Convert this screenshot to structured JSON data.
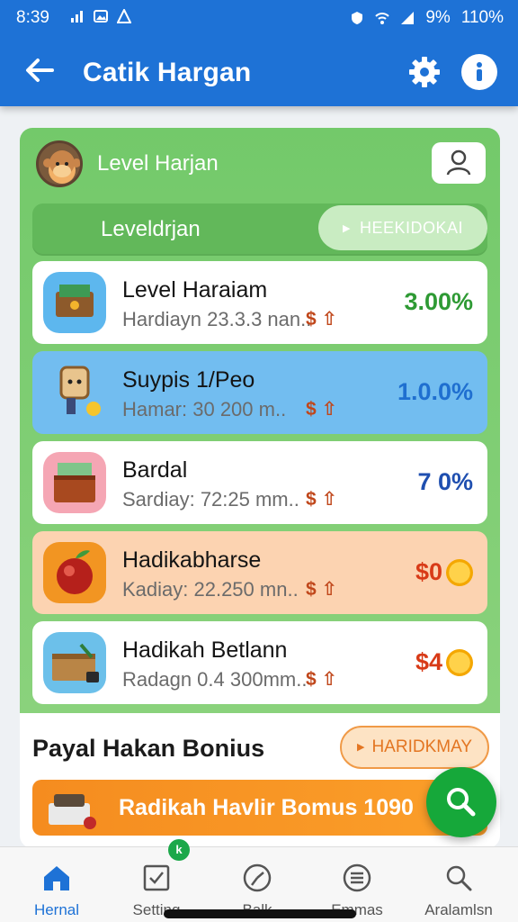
{
  "status": {
    "time": "8:39",
    "battery": "9%",
    "extra": "110%"
  },
  "appbar": {
    "title": "Catik Hargan"
  },
  "header": {
    "title": "Level Harjan",
    "sublabel": "Leveldrjan",
    "button": "HEEKIDOKAI"
  },
  "items": [
    {
      "name": "Level Haraiam",
      "detail": "Hardiayn 23.3.3 nan..",
      "icons": "$ ⇧",
      "value": "3.00%",
      "value_color": "#2e9a34",
      "bg": "#ffffff"
    },
    {
      "name": "Suypis 1/Peo",
      "detail": "Hamar: 30 200 m..",
      "icons": "$ ⇧",
      "value": "1.0.0%",
      "value_color": "#1f6fd0",
      "bg": "#72bdf0"
    },
    {
      "name": "Bardal",
      "detail": "Sardiay: 72:25 mm..",
      "icons": "$ ⇧",
      "value": "7 0%",
      "value_color": "#1f4fb0",
      "bg": "#ffffff"
    },
    {
      "name": "Hadikabharse",
      "detail": "Kadiay: 22.250 mn..",
      "icons": "$ ⇧",
      "value": "$0",
      "value_color": "#d83a17",
      "bg": "#fcd3b1"
    },
    {
      "name": "Hadikah Betlann",
      "detail": "Radagn 0.4 300mm..",
      "icons": "$ ⇧",
      "value": "$4",
      "value_color": "#d83a17",
      "bg": "#ffffff"
    }
  ],
  "bonus": {
    "title": "Payal Hakan Bonius",
    "button": "HARIDKMAY",
    "banner": "Radikah Havlir Bomus 1090"
  },
  "nav": [
    {
      "label": "Hernal"
    },
    {
      "label": "Setting"
    },
    {
      "label": "Balk"
    },
    {
      "label": "Emmas"
    },
    {
      "label": "Aralamlsn"
    }
  ],
  "nav_badge": "k",
  "icons": {
    "back": "arrow-left-icon",
    "settings": "gear-icon",
    "info": "info-icon",
    "profile": "person-icon",
    "search": "search-icon"
  },
  "colors": {
    "appbar": "#1e72d6",
    "card_green": "#73c96a",
    "fab": "#16a83a"
  }
}
